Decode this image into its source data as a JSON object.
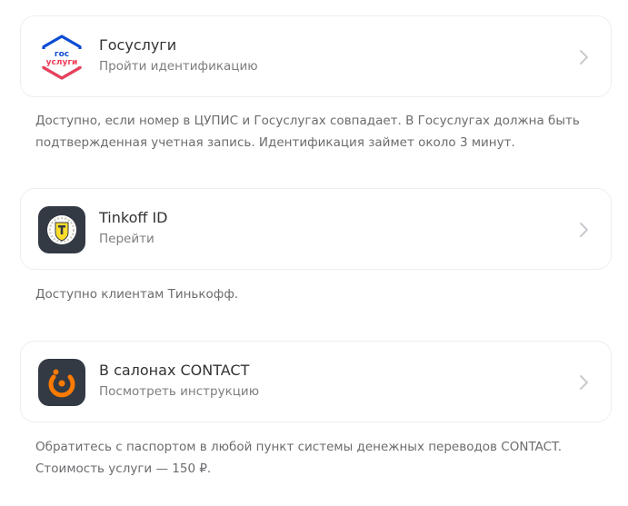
{
  "methods": [
    {
      "title": "Госуслуги",
      "subtitle": "Пройти идентификацию",
      "note": "Доступно, если номер в ЦУПИС и Госуслугах совпадает. В Госуслугах должна быть подтвержденная учетная запись. Идентификация займет около 3 минут.",
      "logo": {
        "icon": "gosuslugi-logo",
        "line1": "гос",
        "line2": "услуги",
        "color_blue": "#0d4cd3",
        "color_red": "#ee3f58"
      }
    },
    {
      "title": "Tinkoff ID",
      "subtitle": "Перейти",
      "note": "Доступно клиентам Тинькофф.",
      "logo": {
        "icon": "tinkoff-logo",
        "bg": "#333a44",
        "accent": "#ffdd2d"
      }
    },
    {
      "title": "В салонах CONTACT",
      "subtitle": "Посмотреть инструкцию",
      "note": "Обратитесь с паспортом в любой пункт системы денежных переводов CONTACT. Стоимость услуги — 150 ₽.",
      "logo": {
        "icon": "contact-logo",
        "bg": "#333a44",
        "accent": "#ff7a00"
      }
    }
  ],
  "chevron_icon": "chevron-right-icon"
}
